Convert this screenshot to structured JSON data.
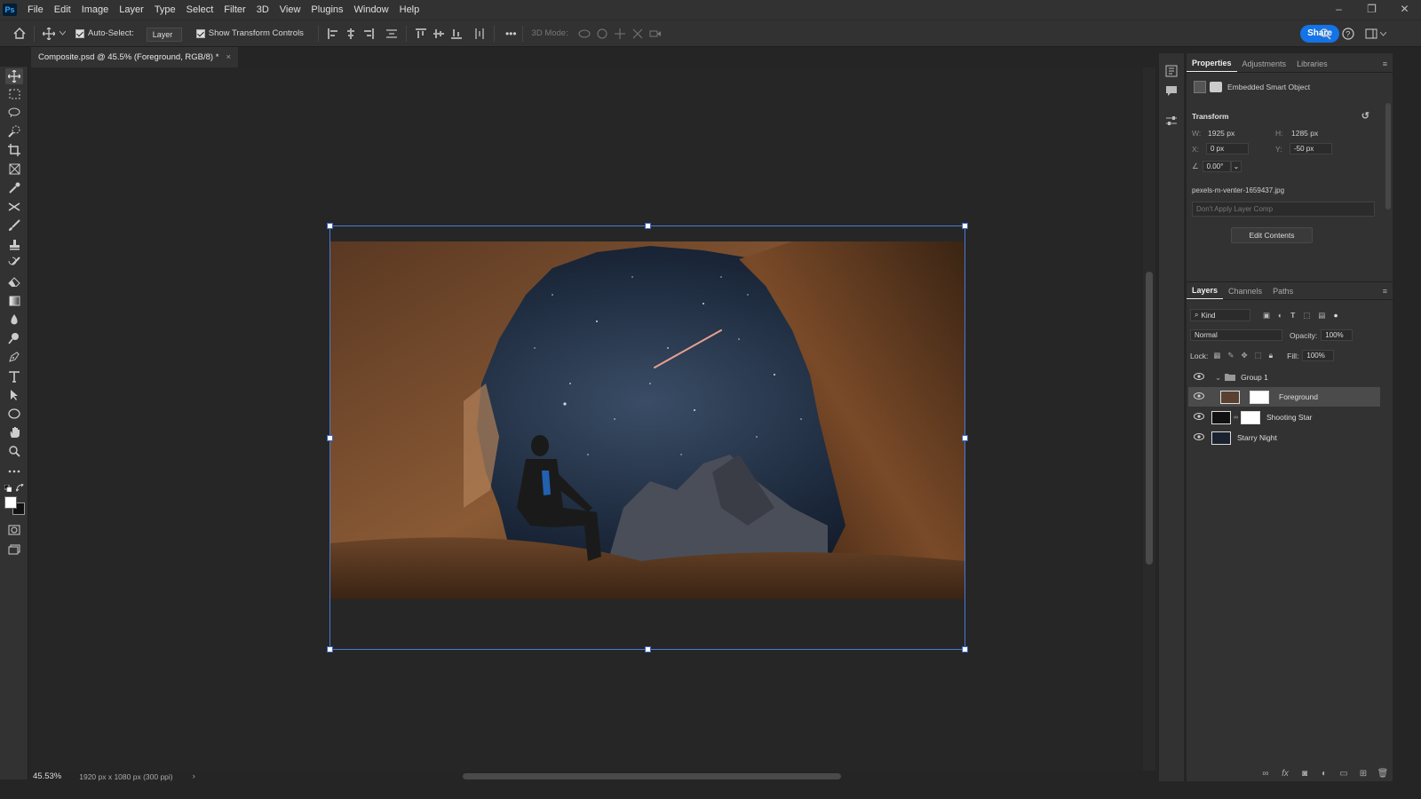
{
  "app": {
    "logo": "Ps"
  },
  "menu": [
    "File",
    "Edit",
    "Image",
    "Layer",
    "Type",
    "Select",
    "Filter",
    "3D",
    "View",
    "Plugins",
    "Window",
    "Help"
  ],
  "window_controls": {
    "minimize": "–",
    "restore": "❐",
    "close": "✕"
  },
  "options": {
    "auto_select_label": "Auto-Select:",
    "auto_select_value": "Layer",
    "show_transform_label": "Show Transform Controls",
    "mode_3d_label": "3D Mode:",
    "more": "•••",
    "share_label": "Share"
  },
  "document": {
    "tab_title": "Composite.psd @ 45.5% (Foreground, RGB/8) *",
    "tab_close": "×"
  },
  "status": {
    "zoom": "45.53%",
    "info": "1920 px x 1080 px (300 ppi)",
    "arrow": "›"
  },
  "properties": {
    "tabs": [
      "Properties",
      "Adjustments",
      "Libraries"
    ],
    "type_label": "Embedded Smart Object",
    "section": "Transform",
    "w_label": "W:",
    "w_value": "1925 px",
    "h_label": "H:",
    "h_value": "1285 px",
    "x_label": "X:",
    "x_value": "0 px",
    "y_label": "Y:",
    "y_value": "-50 px",
    "angle_value": "0.00°",
    "filename": "pexels-m-venter-1659437.jpg",
    "layer_comp": "Don't Apply Layer Comp",
    "edit_contents": "Edit Contents"
  },
  "layers_panel": {
    "tabs": [
      "Layers",
      "Channels",
      "Paths"
    ],
    "kind_label": "Kind",
    "blend_mode": "Normal",
    "opacity_label": "Opacity:",
    "opacity_value": "100%",
    "lock_label": "Lock:",
    "fill_label": "Fill:",
    "fill_value": "100%",
    "layers": [
      {
        "name": "Group 1"
      },
      {
        "name": "Foreground"
      },
      {
        "name": "Shooting Star"
      },
      {
        "name": "Starry Night"
      }
    ]
  },
  "colors": {
    "accent": "#1473e6",
    "selection": "#4a78d8",
    "panel": "#323232",
    "canvas": "#262626"
  }
}
